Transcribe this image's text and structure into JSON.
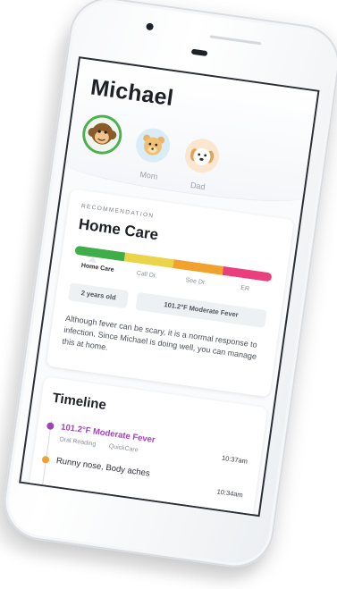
{
  "child": {
    "name": "Michael"
  },
  "profiles": [
    {
      "label": "",
      "icon": "monkey-avatar-icon",
      "selected": true
    },
    {
      "label": "Mom",
      "icon": "bear-avatar-icon",
      "selected": false
    },
    {
      "label": "Dad",
      "icon": "dog-avatar-icon",
      "selected": false
    }
  ],
  "recommendation": {
    "overline": "RECOMMENDATION",
    "title": "Home Care",
    "scale": [
      {
        "label": "Home Care",
        "color": "#3fae49",
        "active": true
      },
      {
        "label": "Call Dr.",
        "color": "#ead44a",
        "active": false
      },
      {
        "label": "See Dr.",
        "color": "#f0a22c",
        "active": false
      },
      {
        "label": "ER",
        "color": "#ea3f7c",
        "active": false
      }
    ],
    "age_chip": "2 years old",
    "fever_chip": "101.2°F Moderate Fever",
    "description": "Although fever can be scary, it is a normal response to infection. Since Michael is doing well, you can manage this at home."
  },
  "timeline": {
    "title": "Timeline",
    "entries": [
      {
        "title": "101.2°F Moderate Fever",
        "subtitle_a": "Oral Reading",
        "subtitle_b": "QuickCare",
        "time": "10:37am",
        "color": "#a43fc0"
      },
      {
        "title": "Runny nose, Body aches",
        "time": "10:34am",
        "color": "#f0a22c"
      }
    ]
  }
}
